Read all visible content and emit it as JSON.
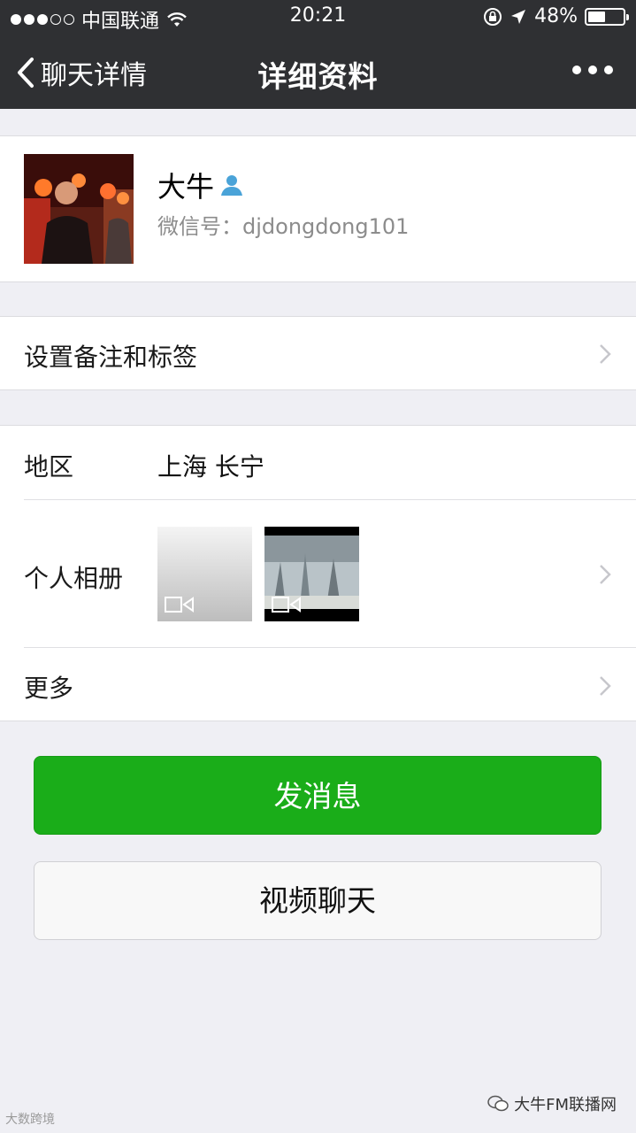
{
  "status_bar": {
    "carrier": "中国联通",
    "time": "20:21",
    "battery": "48%",
    "battery_level": 0.48
  },
  "nav": {
    "back_label": "聊天详情",
    "title": "详细资料"
  },
  "profile": {
    "name": "大牛",
    "wechat_id": "微信号：djdongdong101"
  },
  "remark_row": {
    "label": "设置备注和标签"
  },
  "info": {
    "region_label": "地区",
    "region_value": "上海 长宁",
    "album_label": "个人相册",
    "more_label": "更多"
  },
  "buttons": {
    "send_message": "发消息",
    "video_chat": "视频聊天"
  },
  "watermarks": {
    "left": "大数跨境",
    "right": "大牛FM联播网"
  },
  "colors": {
    "nav_bg": "#2f3033",
    "primary_green": "#1aad19",
    "page_bg": "#efeff4"
  }
}
